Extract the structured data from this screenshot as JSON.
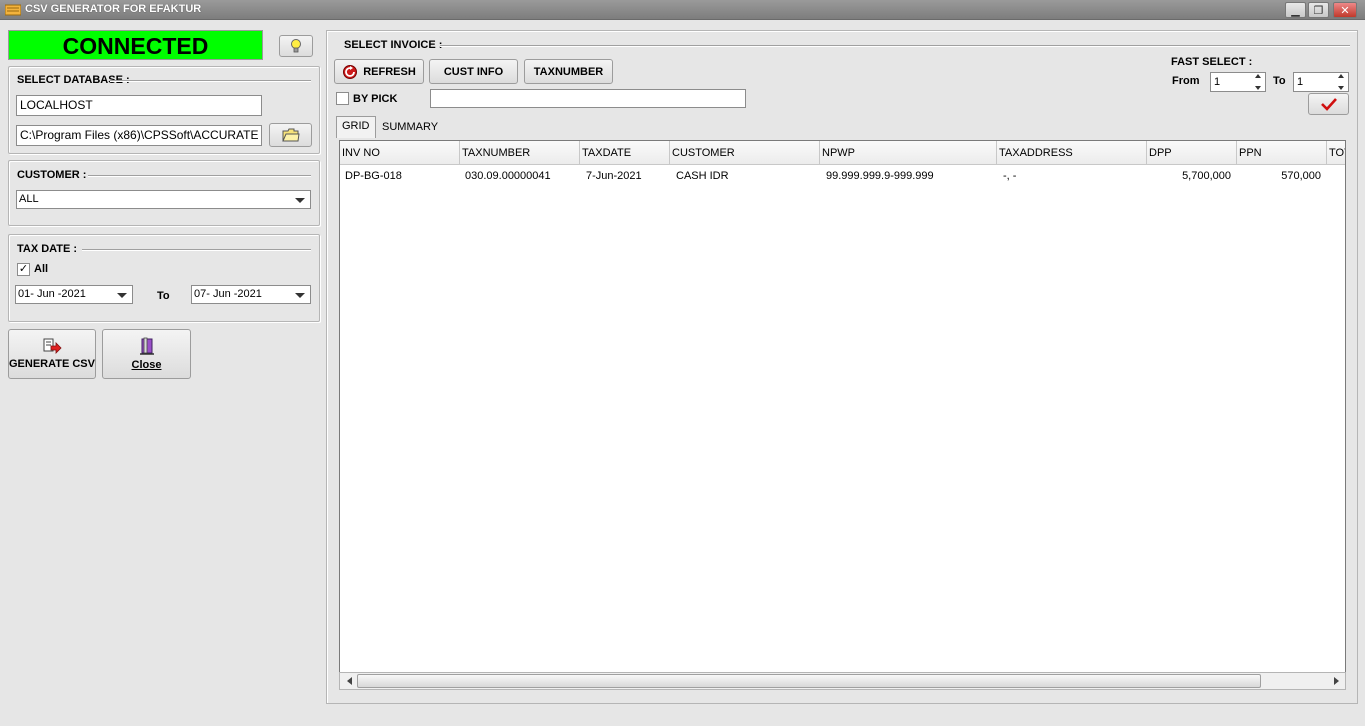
{
  "window": {
    "title": "CSV GENERATOR FOR EFAKTUR"
  },
  "status": {
    "text": "CONNECTED",
    "color": "#00ff00"
  },
  "database": {
    "header": "SELECT DATABASE :",
    "server": "LOCALHOST",
    "path": "C:\\Program Files (x86)\\CPSSoft\\ACCURATE"
  },
  "customer": {
    "header": "CUSTOMER :",
    "selected": "ALL"
  },
  "taxdate": {
    "header": "TAX DATE :",
    "all_label": "All",
    "all_checked": "✓",
    "from": "01- Jun -2021",
    "to_label": "To",
    "to": "07- Jun -2021"
  },
  "actions": {
    "generate_label": "GENERATE CSV",
    "close_label": "Close"
  },
  "invoice": {
    "header": "SELECT INVOICE :",
    "refresh_label": "REFRESH",
    "cust_info_label": "CUST INFO",
    "taxnumber_label": "TAXNUMBER",
    "by_pick_label": "BY PICK",
    "by_pick_value": ""
  },
  "fast_select": {
    "header": "FAST SELECT :",
    "from_label": "From",
    "from_value": "1",
    "to_label": "To",
    "to_value": "1"
  },
  "tabs": [
    "GRID",
    "SUMMARY"
  ],
  "grid": {
    "columns": [
      "INV NO",
      "TAXNUMBER",
      "TAXDATE",
      "CUSTOMER",
      "NPWP",
      "TAXADDRESS",
      "DPP",
      "PPN",
      "TOT"
    ],
    "rows": [
      [
        "DP-BG-018",
        "030.09.00000041",
        "7-Jun-2021",
        "CASH IDR",
        "99.999.999.9-999.999",
        "-, -",
        "5,700,000",
        "570,000",
        ""
      ]
    ]
  }
}
